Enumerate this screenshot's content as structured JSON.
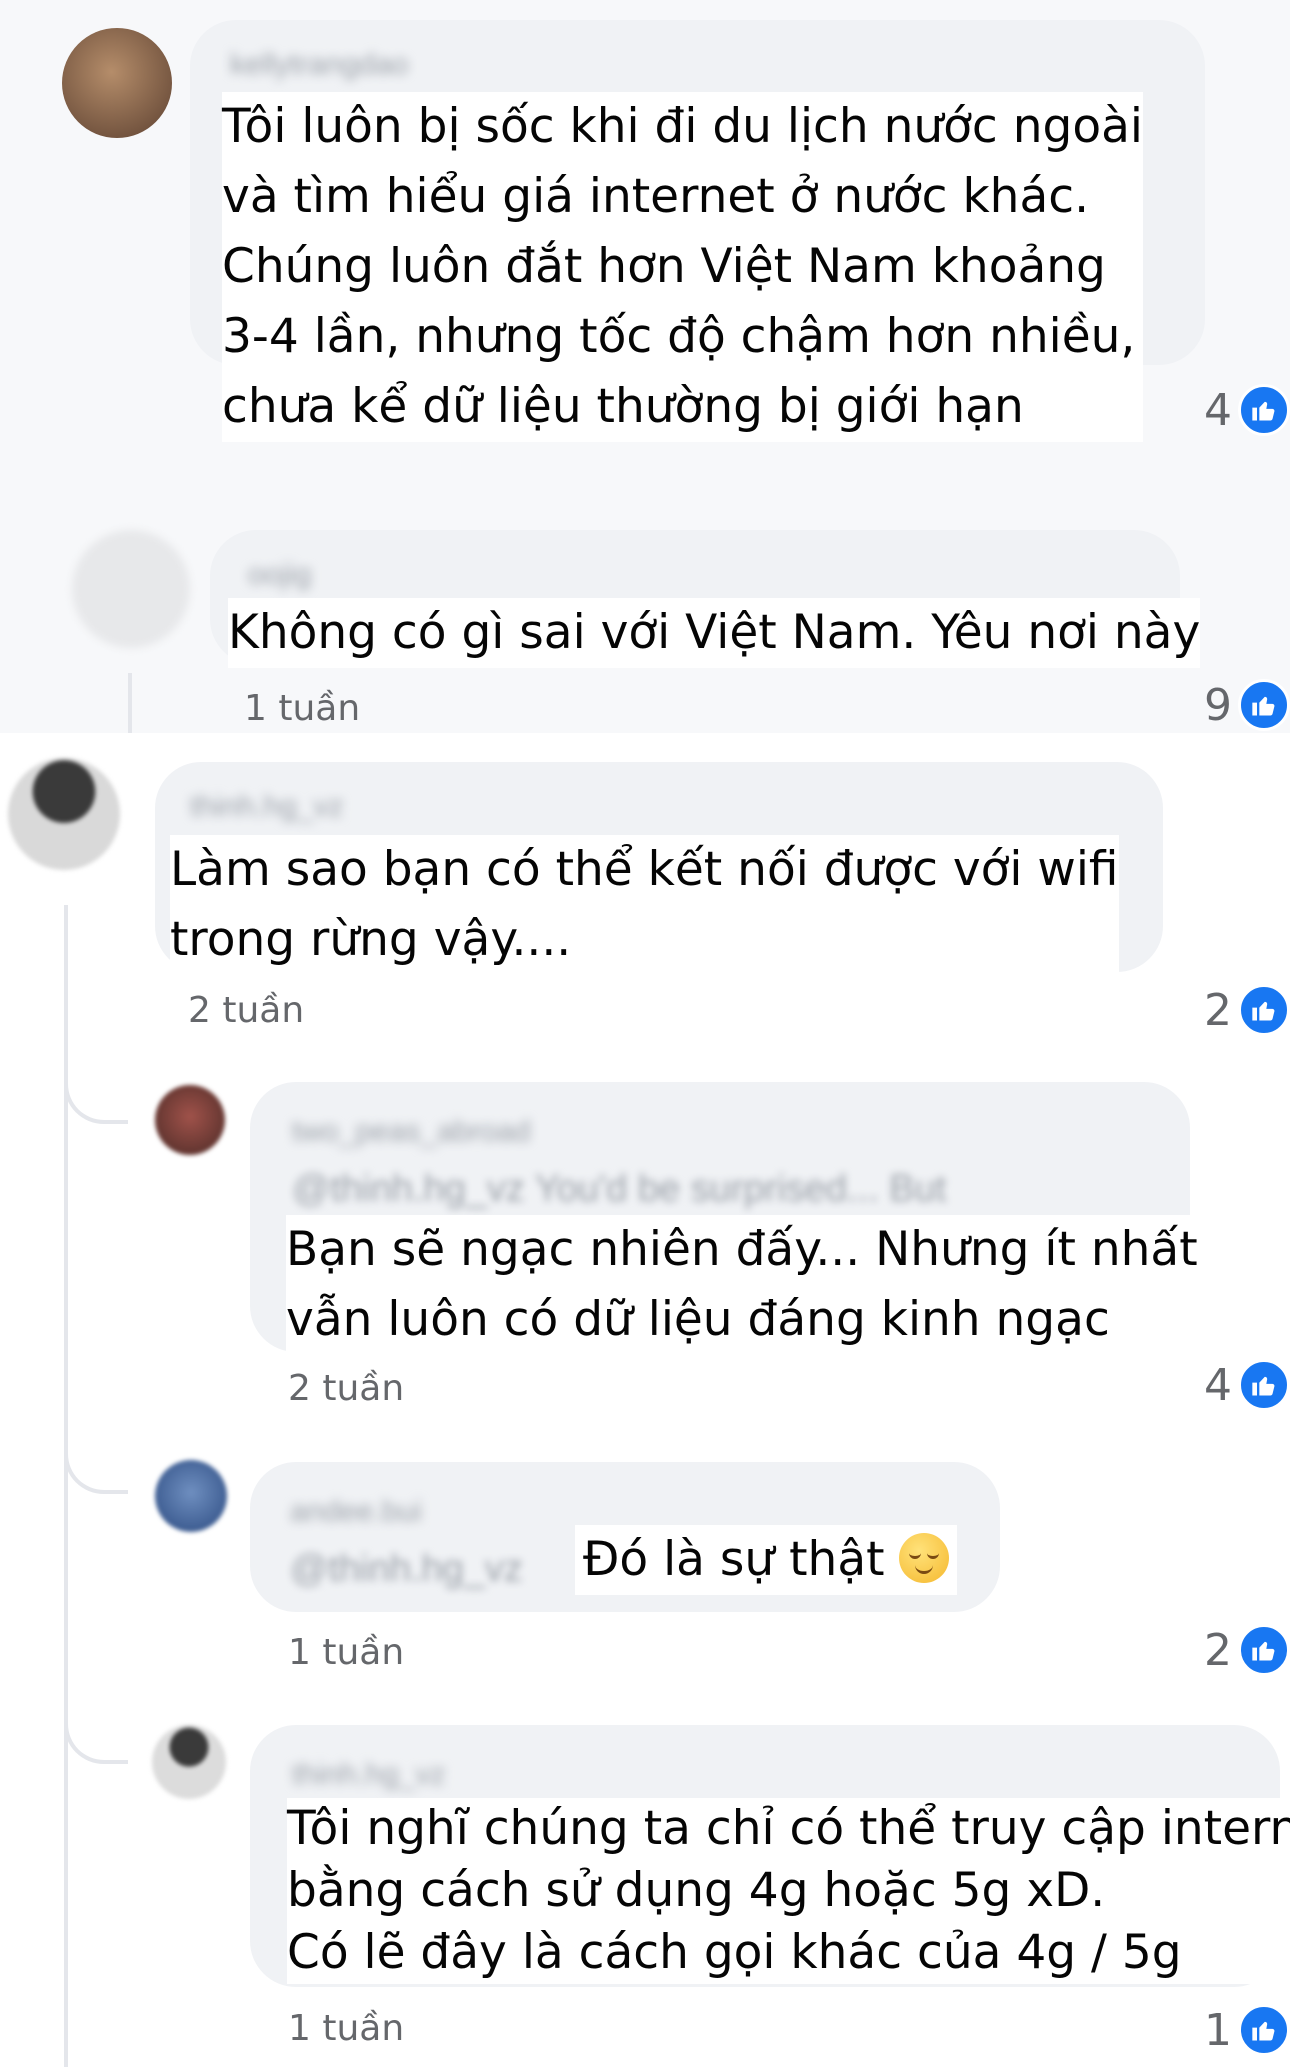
{
  "comments": [
    {
      "id": "c1",
      "username": "kellytrangdao",
      "text_lines": [
        "Tôi luôn bị sốc khi đi du lịch nước ngoài",
        "và tìm hiểu giá internet ở nước khác.",
        "Chúng luôn đắt hơn Việt Nam khoảng",
        "3-4 lần, nhưng tốc độ chậm hơn nhiều,",
        "chưa kể dữ liệu thường bị giới hạn"
      ],
      "likes": "4"
    },
    {
      "id": "c2",
      "username": "oojig",
      "text_lines": [
        "Không có gì sai với Việt Nam. Yêu nơi này"
      ],
      "time": "1 tuần",
      "likes": "9"
    },
    {
      "id": "c3",
      "username": "thinh.hg_vz",
      "text_lines": [
        "Làm sao bạn có thể kết nối được với wifi",
        "trong rừng vậy...."
      ],
      "time": "2 tuần",
      "likes": "2"
    },
    {
      "id": "c4",
      "username": "two_peas_abroad",
      "mention": "@thinh.hg_vz You'd be surprised... But",
      "text_lines": [
        "Bạn sẽ ngạc nhiên đấy... Nhưng ít nhất",
        "vẫn luôn có dữ liệu đáng kinh ngạc"
      ],
      "time": "2 tuần",
      "likes": "4"
    },
    {
      "id": "c5",
      "username": "andee.bui",
      "mention": "@thinh.hg_vz",
      "text_lines": [
        "Đó là sự thật"
      ],
      "emoji": "relieved-face-emoji",
      "time": "1 tuần",
      "likes": "2"
    },
    {
      "id": "c6",
      "username": "thinh.hg_vz",
      "text_lines": [
        "Tôi nghĩ chúng ta chỉ có thể truy cập internet",
        "bằng cách sử dụng 4g hoặc 5g xD.",
        "Có lẽ đây là cách gọi khác của 4g / 5g"
      ],
      "time": "1 tuần",
      "likes": "1"
    }
  ],
  "colors": {
    "bubble": "#f0f2f5",
    "like_blue": "#1877f2",
    "meta_gray": "#65676b",
    "thread_line": "#e4e6eb"
  },
  "icons": {
    "like": "thumbs-up-icon",
    "avatar": "avatar"
  }
}
